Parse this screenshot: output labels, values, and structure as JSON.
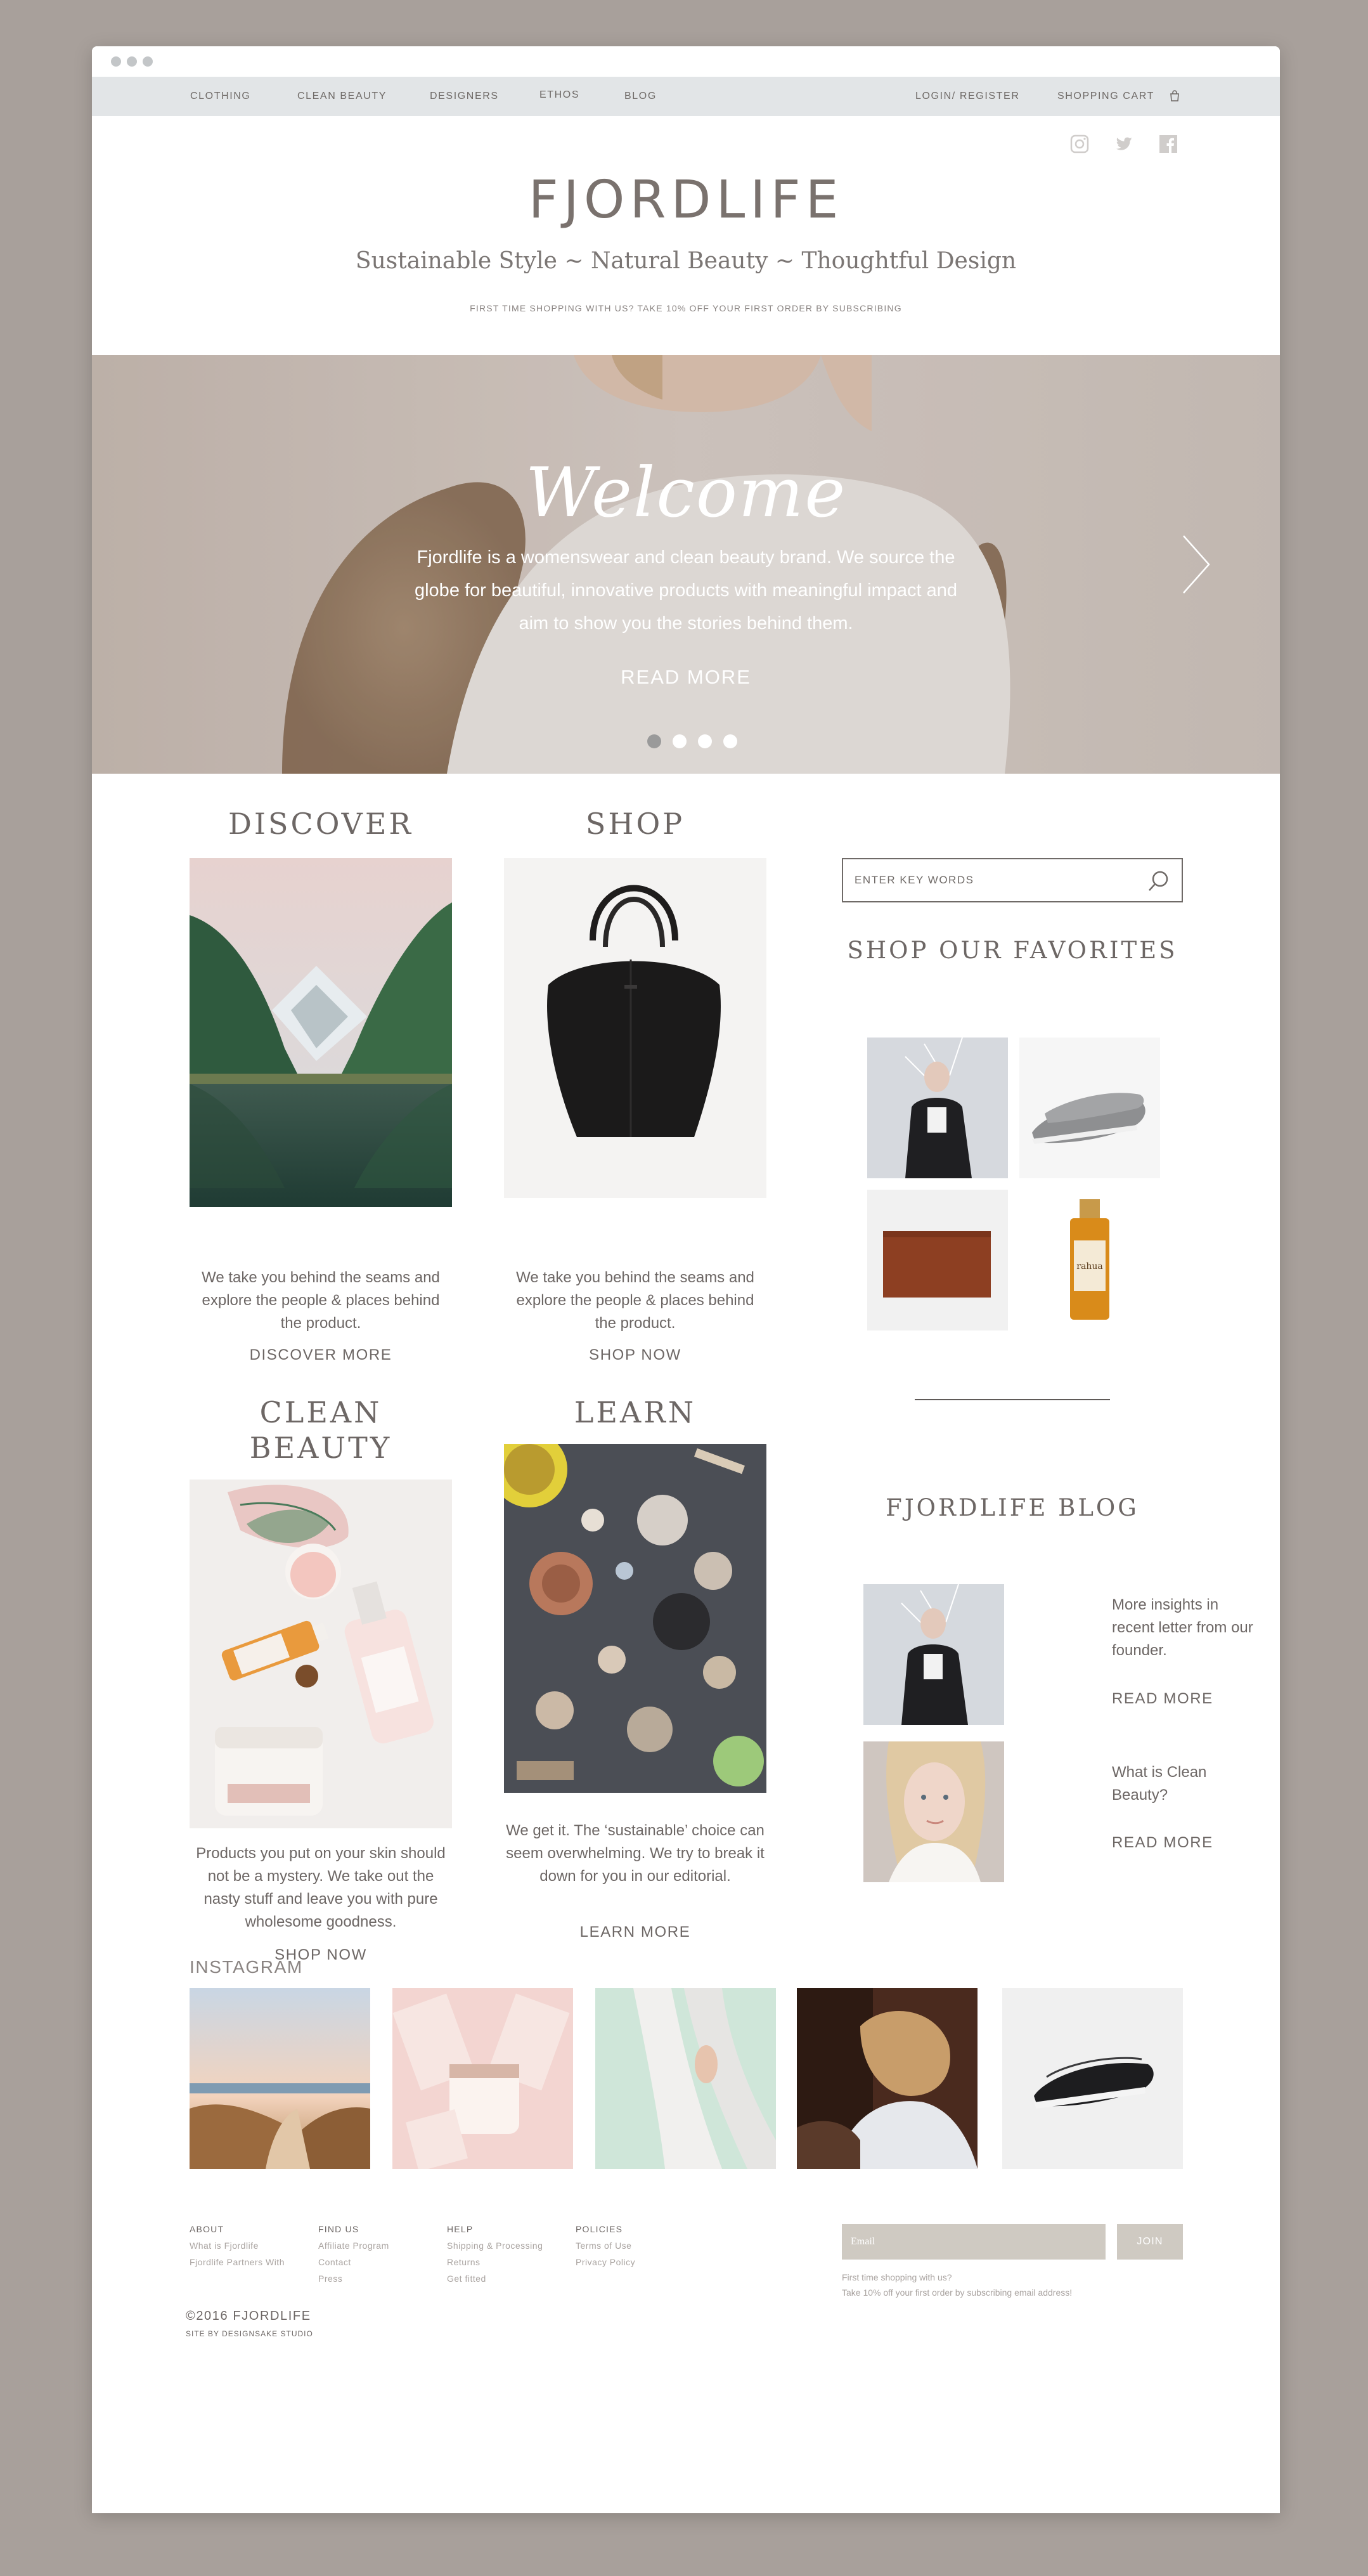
{
  "nav": {
    "left": [
      "CLOTHING",
      "CLEAN BEAUTY",
      "DESIGNERS",
      "ETHOS",
      "BLOG"
    ],
    "login": "LOGIN/ REGISTER",
    "cart": "SHOPPING CART",
    "cart_icon": "shopping-bag-icon"
  },
  "social": [
    "instagram-icon",
    "twitter-icon",
    "facebook-icon"
  ],
  "brand": {
    "logo": "FJORDLIFE",
    "tagline": "Sustainable Style ~ Natural Beauty ~ Thoughtful Design",
    "promo": "FIRST TIME SHOPPING WITH US? TAKE 10% OFF YOUR FIRST ORDER BY SUBSCRIBING"
  },
  "hero": {
    "title": "Welcome",
    "text": "Fjordlife is a womenswear and clean beauty brand. We source the globe for beautiful, innovative products with meaningful impact and aim to show you the stories behind them.",
    "more": "READ MORE",
    "slides": 4,
    "active_slide": 1,
    "next_icon": "chevron-right-icon"
  },
  "cards": {
    "discover": {
      "title": "DISCOVER",
      "text": "We take you behind the seams and explore the people & places behind the product.",
      "link": "DISCOVER MORE"
    },
    "shop": {
      "title": "SHOP",
      "text": "We take you behind the seams and explore the people & places behind the product.",
      "link": "SHOP NOW"
    },
    "beauty": {
      "title": "CLEAN BEAUTY",
      "text": "Products you put on your skin should not be a mystery. We take out the nasty stuff and leave you with pure wholesome goodness.",
      "link": "SHOP NOW"
    },
    "learn": {
      "title": "LEARN",
      "text": "We get it. The ‘sustainable’ choice can seem overwhelming. We try to break it down for you in our editorial.",
      "link": "LEARN MORE"
    }
  },
  "sidebar": {
    "search_placeholder": "ENTER KEY WORDS",
    "favorites_title": "SHOP OUR FAVORITES",
    "blog_title": "FJORDLIFE BLOG",
    "posts": [
      {
        "text": "More insights in recent letter from our founder.",
        "link": "READ MORE"
      },
      {
        "text": "What is Clean Beauty?",
        "link": "READ MORE"
      }
    ]
  },
  "instagram": {
    "title": "INSTAGRAM"
  },
  "footer": {
    "columns": [
      {
        "head": "ABOUT",
        "links": [
          "What is Fjordlife",
          "Fjordlife Partners With"
        ]
      },
      {
        "head": "FIND US",
        "links": [
          "Affiliate Program",
          "Contact",
          "Press"
        ]
      },
      {
        "head": "HELP",
        "links": [
          "Shipping & Processing",
          "Returns",
          "Get fitted"
        ]
      },
      {
        "head": "POLICIES",
        "links": [
          "Terms of Use",
          "Privacy Policy"
        ]
      }
    ],
    "email_placeholder": "Email",
    "join": "JOIN",
    "note1": "First time shopping with us?",
    "note2": "Take 10% off your first order by subscribing email address!",
    "copyright": "©2016  FJORDLIFE",
    "credit": "SITE BY DESIGNSAKE STUDIO"
  }
}
